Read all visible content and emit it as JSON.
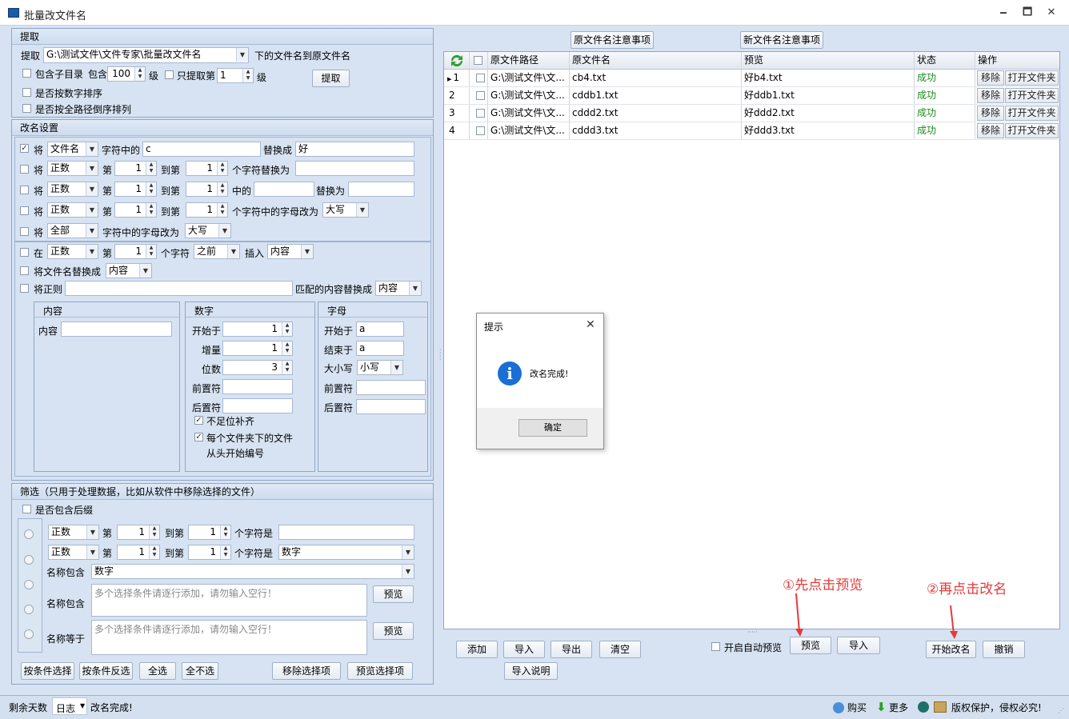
{
  "window": {
    "title": "批量改文件名",
    "min": "🗕",
    "max": "🗖",
    "close": "✕"
  },
  "extract": {
    "group_title": "提取",
    "label": "提取",
    "path": "G:\\测试文件\\文件专家\\批量改文件名",
    "suffix": "下的文件名到原文件名",
    "include_sub": "包含子目录",
    "include": "包含",
    "level_val": "100",
    "level": "级",
    "only_extract": "只提取第",
    "only_val": "1",
    "only_level": "级",
    "btn": "提取",
    "sort_num": "是否按数字排序",
    "sort_rev": "是否按全路径倒序排列"
  },
  "rename": {
    "group_title": "改名设置",
    "jiang": "将",
    "r1": {
      "sel": "文件名",
      "mid": "字符中的",
      "val": "c",
      "repl": "替换成",
      "val2": "好"
    },
    "r2": {
      "sel": "正数",
      "di": "第",
      "a": "1",
      "to": "到第",
      "b": "1",
      "tail": "个字符替换为"
    },
    "r3": {
      "sel": "正数",
      "di": "第",
      "a": "1",
      "to": "到第",
      "b": "1",
      "mid": "中的",
      "repl": "替换为"
    },
    "r4": {
      "sel": "正数",
      "di": "第",
      "a": "1",
      "to": "到第",
      "b": "1",
      "tail": "个字符中的字母改为",
      "case": "大写"
    },
    "r5": {
      "sel": "全部",
      "mid": "字符中的字母改为",
      "case": "大写"
    },
    "r6": {
      "zai": "在",
      "sel": "正数",
      "di": "第",
      "a": "1",
      "tail": "个字符",
      "pos": "之前",
      "ins": "插入",
      "what": "内容"
    },
    "r7": {
      "label": "将文件名替换成",
      "what": "内容"
    },
    "r8": {
      "label": "将正则",
      "mid": "匹配的内容替换成",
      "what": "内容"
    },
    "content": {
      "title": "内容",
      "label": "内容"
    },
    "number": {
      "title": "数字",
      "start": "开始于",
      "start_val": "1",
      "inc": "增量",
      "inc_val": "1",
      "digits": "位数",
      "digits_val": "3",
      "prefix": "前置符",
      "suffix": "后置符",
      "pad": "不足位补齐",
      "per_folder": "每个文件夹下的文件",
      "per_folder2": "从头开始编号"
    },
    "letter": {
      "title": "字母",
      "start": "开始于",
      "start_val": "a",
      "end": "结束于",
      "end_val": "a",
      "case": "大小写",
      "case_val": "小写",
      "prefix": "前置符",
      "suffix": "后置符"
    }
  },
  "filter": {
    "group_title": "筛选（只用于处理数据，比如从软件中移除选择的文件）",
    "has_ext": "是否包含后缀",
    "f1": {
      "sel": "正数",
      "di": "第",
      "a": "1",
      "to": "到第",
      "b": "1",
      "tail": "个字符是"
    },
    "f2": {
      "sel": "正数",
      "di": "第",
      "a": "1",
      "to": "到第",
      "b": "1",
      "tail": "个字符是",
      "val": "数字"
    },
    "f3": {
      "label": "名称包含",
      "val": "数字"
    },
    "f4": {
      "label": "名称包含",
      "ph": "多个选择条件请逐行添加，请勿输入空行！",
      "btn": "预览"
    },
    "f5": {
      "label": "名称等于",
      "ph": "多个选择条件请逐行添加，请勿输入空行！",
      "btn": "预览"
    },
    "btns": [
      "按条件选择",
      "按条件反选",
      "全选",
      "全不选",
      "移除选择项",
      "预览选择项"
    ]
  },
  "grid": {
    "note_old": "原文件名注意事项",
    "note_new": "新文件名注意事项",
    "cols": [
      "原文件路径",
      "原文件名",
      "预览",
      "状态",
      "操作"
    ],
    "rows": [
      {
        "n": "1",
        "path": "G:\\测试文件\\文...",
        "old": "cb4.txt",
        "new": "好b4.txt",
        "st": "成功"
      },
      {
        "n": "2",
        "path": "G:\\测试文件\\文...",
        "old": "cddb1.txt",
        "new": "好ddb1.txt",
        "st": "成功"
      },
      {
        "n": "3",
        "path": "G:\\测试文件\\文...",
        "old": "cddd2.txt",
        "new": "好ddd2.txt",
        "st": "成功"
      },
      {
        "n": "4",
        "path": "G:\\测试文件\\文...",
        "old": "cddd3.txt",
        "new": "好ddd3.txt",
        "st": "成功"
      }
    ],
    "remove": "移除",
    "open": "打开文件夹"
  },
  "bottom": {
    "add": "添加",
    "import": "导入",
    "export": "导出",
    "clear": "清空",
    "import_help": "导入说明",
    "auto_preview": "开启自动预览",
    "preview": "预览",
    "import2": "导入",
    "start": "开始改名",
    "cancel": "撤销"
  },
  "annot": {
    "a1": "①先点击预览",
    "a2": "②再点击改名"
  },
  "dialog": {
    "title": "提示",
    "msg": "改名完成!",
    "ok": "确定"
  },
  "status": {
    "days": "剩余天数",
    "log": "日志",
    "msg": "改名完成!",
    "buy": "购买",
    "more": "更多",
    "copyright": "版权保护，侵权必究!"
  }
}
